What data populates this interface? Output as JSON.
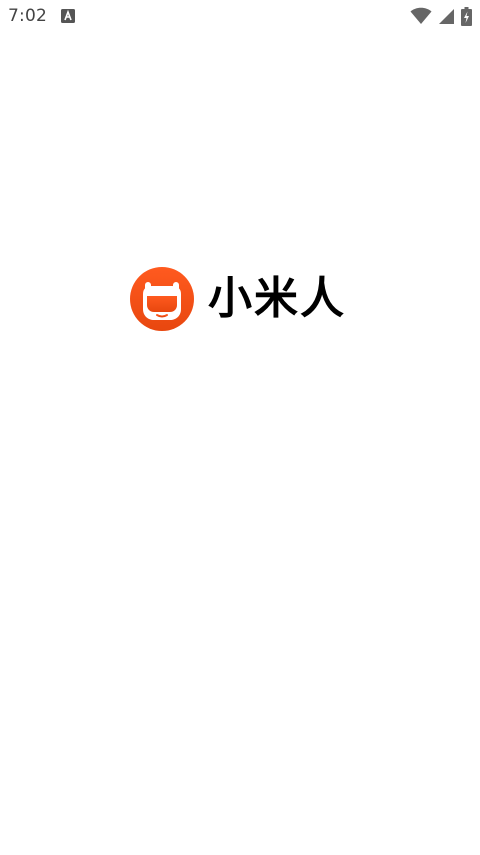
{
  "status_bar": {
    "time": "7:02",
    "notification_icon": "keyboard-a-icon",
    "wifi_icon": "wifi-icon",
    "signal_icon": "cell-signal-icon",
    "battery_icon": "battery-charging-icon"
  },
  "splash": {
    "app_name": "小米人",
    "logo_icon": "mi-bunny-logo-icon",
    "logo_colors": {
      "top": "#ff5a1f",
      "bottom": "#e8470f"
    }
  }
}
